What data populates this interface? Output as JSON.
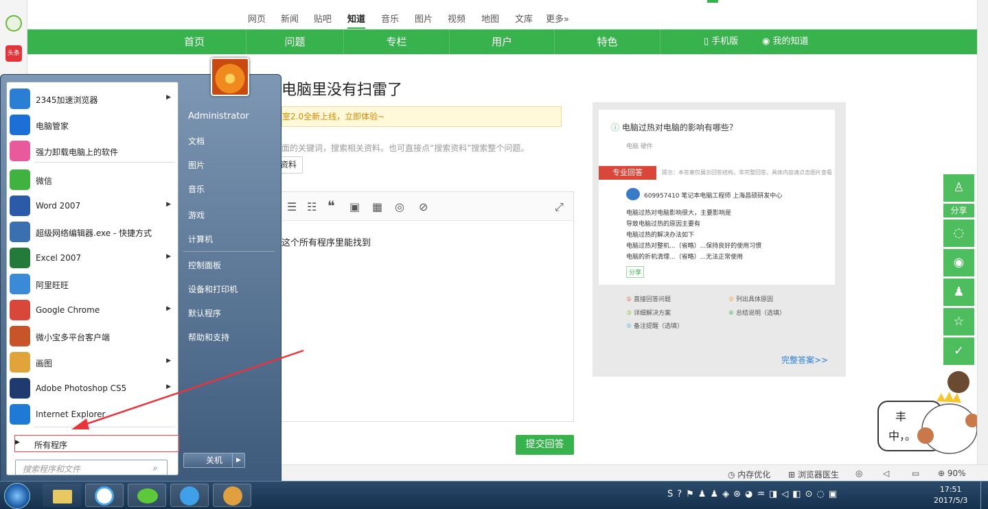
{
  "leftdock": {
    "toutiao_label": "头条"
  },
  "topnav": {
    "items": [
      "网页",
      "新闻",
      "贴吧",
      "知道",
      "音乐",
      "图片",
      "视频",
      "地图",
      "文库",
      "更多»"
    ]
  },
  "greenbar": {
    "items": [
      "首页",
      "问题",
      "专栏",
      "用户",
      "特色"
    ],
    "mobile": "手机版",
    "mine": "我的知道"
  },
  "content": {
    "title": "电脑里没有扫雷了",
    "notice": "室2.0全新上线，立即体验~",
    "hint": "面的关键词，搜索相关资料。也可直接点“搜索资料”搜索整个问题。",
    "search_btn": "资料",
    "editor_text": "这个所有程序里能找到",
    "submit": "提交回答"
  },
  "card": {
    "question": "电脑过热对电脑的影响有哪些？",
    "tags": "电脑    硬件",
    "badge": "专业回答",
    "note": "提示：本答案仅展示回答结构，非完整回答，具体内容请点击图片查看",
    "user": "609957410      笔记本电脑工程师      上海昌硕研发中心",
    "lines": [
      "电脑过热对电脑影响很大，主要影响是",
      "导致电脑过热的原因主要有",
      "电脑过热的解决办法如下",
      "电脑过热对整机...（省略）...保持良好的使用习惯",
      "电脑的折机清理...（省略）...无法正常使用"
    ],
    "share": "分享",
    "legend": [
      "直接回答问题",
      "列出具体原因",
      "详细解决方案",
      "总结说明（选填）",
      "备注提醒（选填）"
    ],
    "full": "完整答案>>"
  },
  "sidebar": {
    "share": "分享"
  },
  "statusbar": {
    "mem": "内存优化",
    "doctor": "浏览器医生",
    "zoom": "90%"
  },
  "startmenu": {
    "programs": [
      {
        "label": "2345加速浏览器",
        "arrow": true,
        "color": "#2a7fd4"
      },
      {
        "label": "电脑管家",
        "arrow": false,
        "color": "#1d6fd8"
      },
      {
        "label": "强力卸载电脑上的软件",
        "arrow": false,
        "color": "#e85a9b"
      },
      {
        "label": "微信",
        "arrow": false,
        "color": "#3fb23f"
      },
      {
        "label": "Word 2007",
        "arrow": true,
        "color": "#2b5aa8"
      },
      {
        "label": "超级网络编辑器.exe - 快捷方式",
        "arrow": false,
        "color": "#3a6fb0"
      },
      {
        "label": "Excel 2007",
        "arrow": true,
        "color": "#237a3b"
      },
      {
        "label": "阿里旺旺",
        "arrow": false,
        "color": "#3a8ad8"
      },
      {
        "label": "Google Chrome",
        "arrow": true,
        "color": "#d9463a"
      },
      {
        "label": "微小宝多平台客户端",
        "arrow": false,
        "color": "#c8542a"
      },
      {
        "label": "画图",
        "arrow": true,
        "color": "#e0a43a"
      },
      {
        "label": "Adobe Photoshop CS5",
        "arrow": true,
        "color": "#1e3a6e"
      },
      {
        "label": "Internet Explorer",
        "arrow": false,
        "color": "#1f7ad6"
      }
    ],
    "all_programs": "所有程序",
    "search_placeholder": "搜索程序和文件",
    "right": [
      "Administrator",
      "文档",
      "图片",
      "音乐",
      "游戏",
      "计算机",
      "控制面板",
      "设备和打印机",
      "默认程序",
      "帮助和支持"
    ],
    "shutdown": "关机"
  },
  "taskbar": {
    "time": "17:51",
    "date": "2017/5/3"
  },
  "mascot": {
    "text1": "丰",
    "text2": "中，。"
  }
}
